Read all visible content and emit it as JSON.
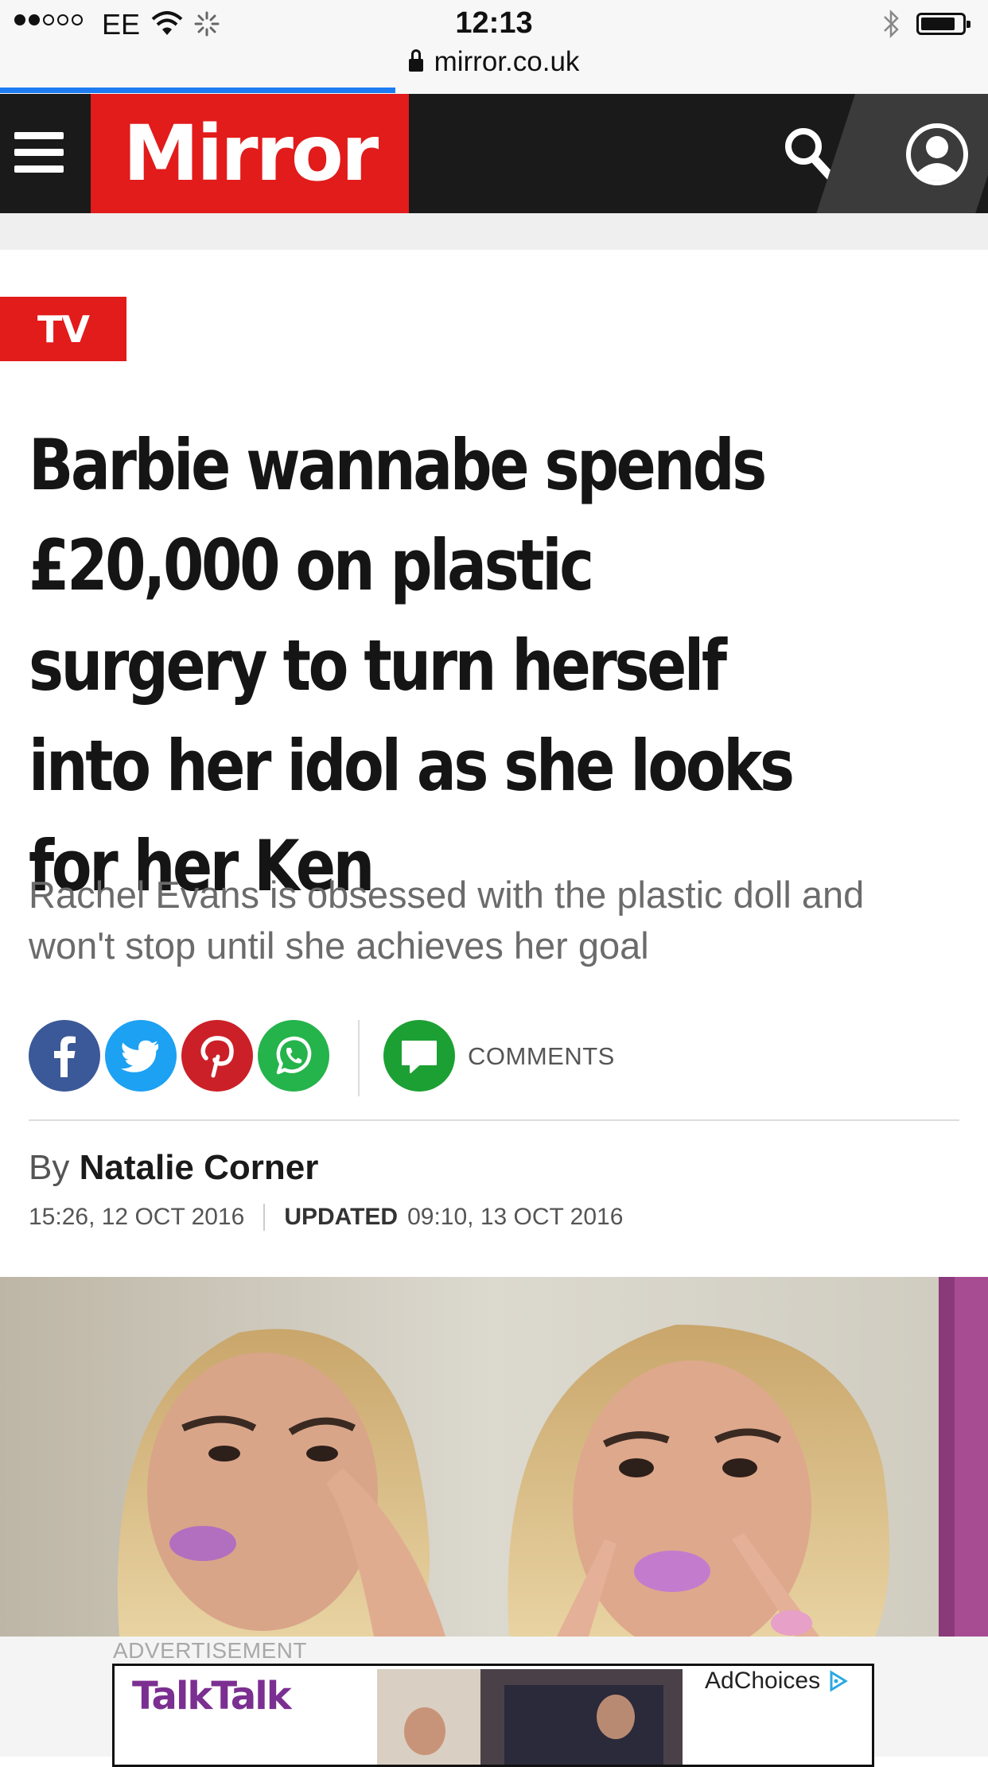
{
  "status_bar": {
    "carrier": "EE",
    "time": "12:13",
    "url": "mirror.co.uk",
    "page_load_progress": 0.4
  },
  "header": {
    "logo_text": "Mirror",
    "brand_color": "#e21b1b",
    "menu_icon": "hamburger-icon",
    "search_icon": "search-icon",
    "account_icon": "user-account-icon"
  },
  "article": {
    "section_tag": "TV",
    "headline": "Barbie wannabe spends £20,000 on plastic surgery to turn herself into her idol as she looks for her Ken",
    "standfirst": "Rachel Evans is obsessed with the plastic doll and won't stop until she achieves her goal",
    "share": {
      "facebook_icon": "facebook-icon",
      "twitter_icon": "twitter-icon",
      "pinterest_icon": "pinterest-icon",
      "whatsapp_icon": "whatsapp-icon",
      "comments_label": "COMMENTS"
    },
    "byline_prefix": "By",
    "author": "Natalie Corner",
    "published": "15:26, 12 OCT 2016",
    "updated_label": "UPDATED",
    "updated": "09:10, 13 OCT 2016"
  },
  "advert": {
    "label": "ADVERTISEMENT",
    "brand": "TalkTalk",
    "adchoices": "AdChoices"
  },
  "colors": {
    "facebook": "#3b5998",
    "twitter": "#1da1f2",
    "pinterest": "#cb2027",
    "whatsapp": "#25b34b",
    "comments": "#1da033",
    "progress": "#1d7cf2"
  }
}
